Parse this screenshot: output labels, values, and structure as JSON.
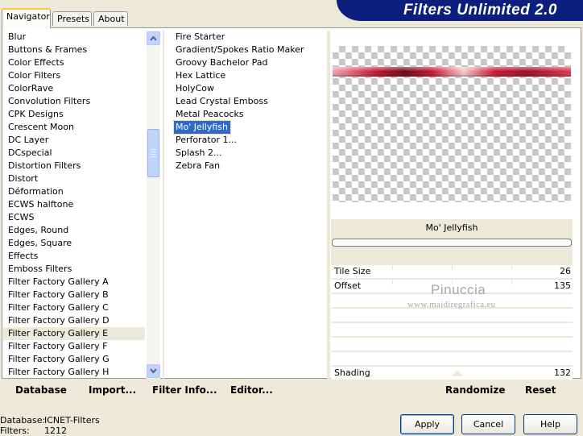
{
  "banner": {
    "title": "Filters Unlimited 2.0"
  },
  "tabs": [
    "Navigator",
    "Presets",
    "About"
  ],
  "categories": [
    "Blur",
    "Buttons & Frames",
    "Color Effects",
    "Color Filters",
    "ColorRave",
    "Convolution Filters",
    "CPK Designs",
    "Crescent Moon",
    "DC Layer",
    "DCspecial",
    "Distortion Filters",
    "Distort",
    "Déformation",
    "ECWS halftone",
    "ECWS",
    "Edges, Round",
    "Edges, Square",
    "Effects",
    "Emboss Filters",
    "Filter Factory Gallery A",
    "Filter Factory Gallery B",
    "Filter Factory Gallery C",
    "Filter Factory Gallery D",
    "Filter Factory Gallery E",
    "Filter Factory Gallery F",
    "Filter Factory Gallery G",
    "Filter Factory Gallery H"
  ],
  "selected_category": "Filter Factory Gallery E",
  "filters": [
    "Fire Starter",
    "Gradient/Spokes Ratio Maker",
    "Groovy Bachelor Pad",
    "Hex Lattice",
    "HolyCow",
    "Lead Crystal Emboss",
    "Metal Peacocks",
    "Mo' Jellyfish",
    "Perforator 1...",
    "Splash 2...",
    "Zebra Fan"
  ],
  "selected_filter": "Mo' Jellyfish",
  "preview": {
    "filter_name": "Mo' Jellyfish"
  },
  "sliders": {
    "tile_size": {
      "label": "Tile Size",
      "value": "26"
    },
    "offset": {
      "label": "Offset",
      "value": "135"
    },
    "shading": {
      "label": "Shading",
      "value": "132"
    }
  },
  "watermark": {
    "line1": "Pinuccia",
    "line2": "www.maidiregrafica.eu"
  },
  "actions": {
    "database": "Database",
    "import": "Import...",
    "filter_info": "Filter Info...",
    "editor": "Editor...",
    "randomize": "Randomize",
    "reset": "Reset"
  },
  "status": {
    "database_label": "Database:",
    "database_value": "ICNET-Filters",
    "filters_label": "Filters:",
    "filters_value": "1212"
  },
  "buttons": {
    "apply": "Apply",
    "cancel": "Cancel",
    "help": "Help"
  },
  "colors": {
    "banner": "#0c1e7e",
    "selection": "#316ac5",
    "jellyfish": "#c8102e"
  }
}
